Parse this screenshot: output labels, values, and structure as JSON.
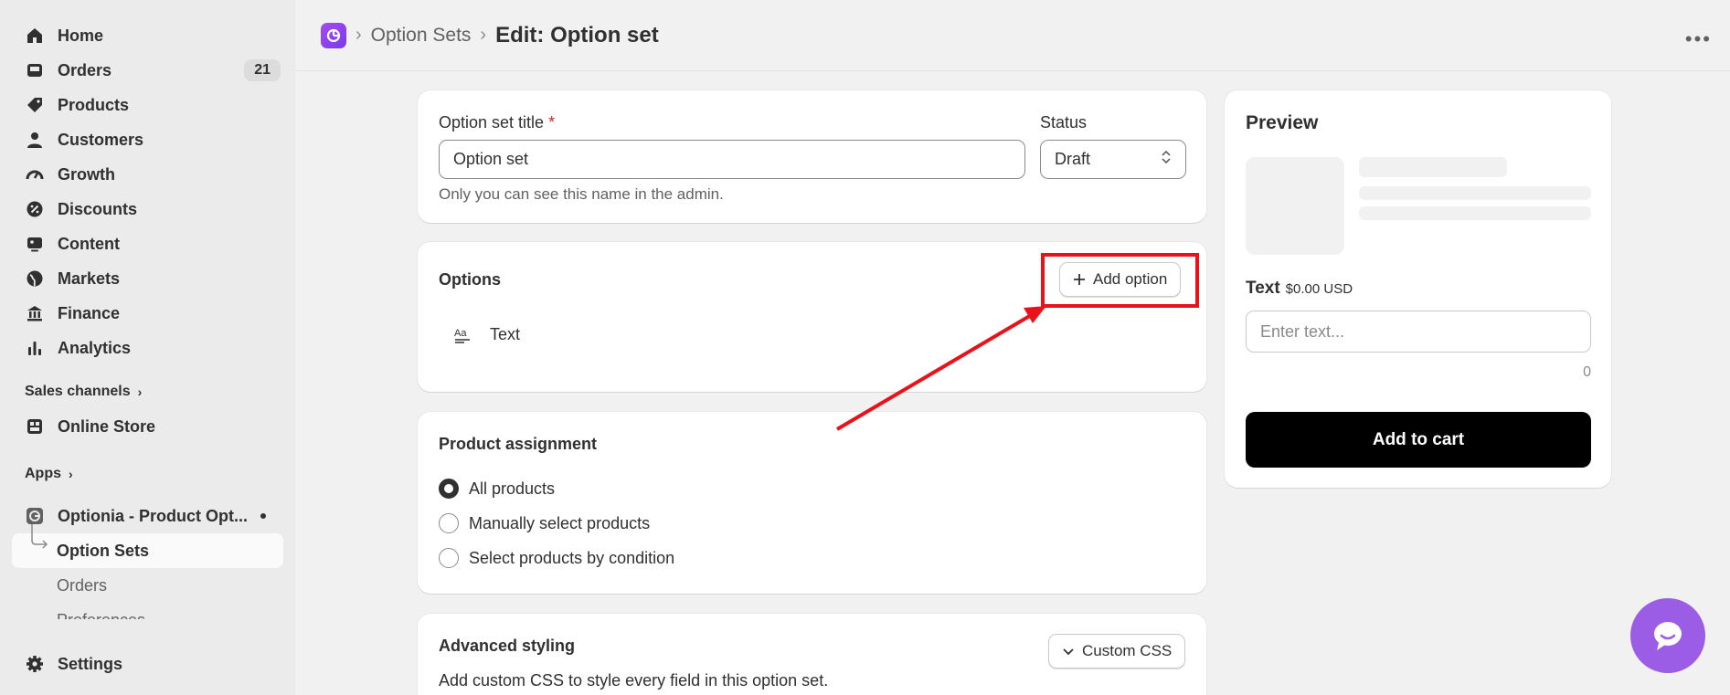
{
  "sidebar": {
    "items": [
      {
        "label": "Home",
        "icon": "home-icon"
      },
      {
        "label": "Orders",
        "icon": "inbox-icon",
        "badge": "21"
      },
      {
        "label": "Products",
        "icon": "tag-icon"
      },
      {
        "label": "Customers",
        "icon": "person-icon"
      },
      {
        "label": "Growth",
        "icon": "gauge-icon"
      },
      {
        "label": "Discounts",
        "icon": "discount-icon"
      },
      {
        "label": "Content",
        "icon": "image-icon"
      },
      {
        "label": "Markets",
        "icon": "globe-icon"
      },
      {
        "label": "Finance",
        "icon": "bank-icon"
      },
      {
        "label": "Analytics",
        "icon": "bar-chart-icon"
      }
    ],
    "sales_channels_label": "Sales channels",
    "online_store_label": "Online Store",
    "apps_label": "Apps",
    "app_name": "Optionia - Product Opt...",
    "app_sub_items": [
      "Option Sets",
      "Orders",
      "Preferences"
    ],
    "settings_label": "Settings"
  },
  "header": {
    "breadcrumb_parent": "Option Sets",
    "title": "Edit: Option set"
  },
  "title_card": {
    "title_label": "Option set title",
    "required_mark": "*",
    "title_value": "Option set",
    "help_text": "Only you can see this name in the admin.",
    "status_label": "Status",
    "status_value": "Draft"
  },
  "options_card": {
    "heading": "Options",
    "add_button_label": "Add option",
    "option_items": [
      {
        "label": "Text",
        "icon": "text-type-icon"
      }
    ]
  },
  "assignment_card": {
    "heading": "Product assignment",
    "choices": [
      {
        "label": "All products",
        "selected": true
      },
      {
        "label": "Manually select products",
        "selected": false
      },
      {
        "label": "Select products by condition",
        "selected": false
      }
    ]
  },
  "advanced_card": {
    "heading": "Advanced styling",
    "button_label": "Custom CSS",
    "description": "Add custom CSS to style every field in this option set."
  },
  "preview": {
    "heading": "Preview",
    "field_label": "Text",
    "price": "$0.00 USD",
    "placeholder": "Enter text...",
    "char_count": "0",
    "add_to_cart_label": "Add to cart"
  },
  "colors": {
    "annotation": "#e8121a",
    "chat_bubble": "#9b5de5",
    "primary_button": "#000000"
  }
}
